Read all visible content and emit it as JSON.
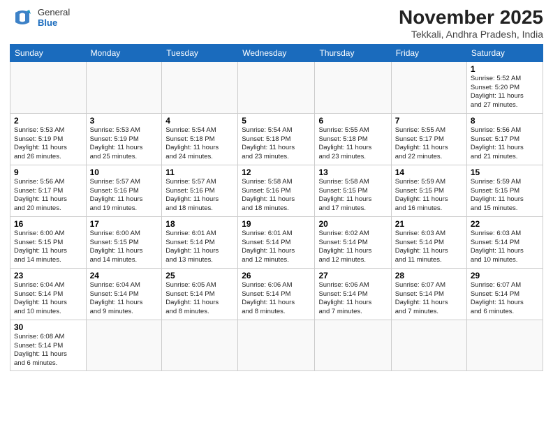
{
  "header": {
    "logo_line1": "General",
    "logo_line2": "Blue",
    "month_title": "November 2025",
    "location": "Tekkali, Andhra Pradesh, India"
  },
  "days": [
    "Sunday",
    "Monday",
    "Tuesday",
    "Wednesday",
    "Thursday",
    "Friday",
    "Saturday"
  ],
  "weeks": [
    [
      {
        "date": "",
        "info": ""
      },
      {
        "date": "",
        "info": ""
      },
      {
        "date": "",
        "info": ""
      },
      {
        "date": "",
        "info": ""
      },
      {
        "date": "",
        "info": ""
      },
      {
        "date": "",
        "info": ""
      },
      {
        "date": "1",
        "info": "Sunrise: 5:52 AM\nSunset: 5:20 PM\nDaylight: 11 hours\nand 27 minutes."
      }
    ],
    [
      {
        "date": "2",
        "info": "Sunrise: 5:53 AM\nSunset: 5:19 PM\nDaylight: 11 hours\nand 26 minutes."
      },
      {
        "date": "3",
        "info": "Sunrise: 5:53 AM\nSunset: 5:19 PM\nDaylight: 11 hours\nand 25 minutes."
      },
      {
        "date": "4",
        "info": "Sunrise: 5:54 AM\nSunset: 5:18 PM\nDaylight: 11 hours\nand 24 minutes."
      },
      {
        "date": "5",
        "info": "Sunrise: 5:54 AM\nSunset: 5:18 PM\nDaylight: 11 hours\nand 23 minutes."
      },
      {
        "date": "6",
        "info": "Sunrise: 5:55 AM\nSunset: 5:18 PM\nDaylight: 11 hours\nand 23 minutes."
      },
      {
        "date": "7",
        "info": "Sunrise: 5:55 AM\nSunset: 5:17 PM\nDaylight: 11 hours\nand 22 minutes."
      },
      {
        "date": "8",
        "info": "Sunrise: 5:56 AM\nSunset: 5:17 PM\nDaylight: 11 hours\nand 21 minutes."
      }
    ],
    [
      {
        "date": "9",
        "info": "Sunrise: 5:56 AM\nSunset: 5:17 PM\nDaylight: 11 hours\nand 20 minutes."
      },
      {
        "date": "10",
        "info": "Sunrise: 5:57 AM\nSunset: 5:16 PM\nDaylight: 11 hours\nand 19 minutes."
      },
      {
        "date": "11",
        "info": "Sunrise: 5:57 AM\nSunset: 5:16 PM\nDaylight: 11 hours\nand 18 minutes."
      },
      {
        "date": "12",
        "info": "Sunrise: 5:58 AM\nSunset: 5:16 PM\nDaylight: 11 hours\nand 18 minutes."
      },
      {
        "date": "13",
        "info": "Sunrise: 5:58 AM\nSunset: 5:15 PM\nDaylight: 11 hours\nand 17 minutes."
      },
      {
        "date": "14",
        "info": "Sunrise: 5:59 AM\nSunset: 5:15 PM\nDaylight: 11 hours\nand 16 minutes."
      },
      {
        "date": "15",
        "info": "Sunrise: 5:59 AM\nSunset: 5:15 PM\nDaylight: 11 hours\nand 15 minutes."
      }
    ],
    [
      {
        "date": "16",
        "info": "Sunrise: 6:00 AM\nSunset: 5:15 PM\nDaylight: 11 hours\nand 14 minutes."
      },
      {
        "date": "17",
        "info": "Sunrise: 6:00 AM\nSunset: 5:15 PM\nDaylight: 11 hours\nand 14 minutes."
      },
      {
        "date": "18",
        "info": "Sunrise: 6:01 AM\nSunset: 5:14 PM\nDaylight: 11 hours\nand 13 minutes."
      },
      {
        "date": "19",
        "info": "Sunrise: 6:01 AM\nSunset: 5:14 PM\nDaylight: 11 hours\nand 12 minutes."
      },
      {
        "date": "20",
        "info": "Sunrise: 6:02 AM\nSunset: 5:14 PM\nDaylight: 11 hours\nand 12 minutes."
      },
      {
        "date": "21",
        "info": "Sunrise: 6:03 AM\nSunset: 5:14 PM\nDaylight: 11 hours\nand 11 minutes."
      },
      {
        "date": "22",
        "info": "Sunrise: 6:03 AM\nSunset: 5:14 PM\nDaylight: 11 hours\nand 10 minutes."
      }
    ],
    [
      {
        "date": "23",
        "info": "Sunrise: 6:04 AM\nSunset: 5:14 PM\nDaylight: 11 hours\nand 10 minutes."
      },
      {
        "date": "24",
        "info": "Sunrise: 6:04 AM\nSunset: 5:14 PM\nDaylight: 11 hours\nand 9 minutes."
      },
      {
        "date": "25",
        "info": "Sunrise: 6:05 AM\nSunset: 5:14 PM\nDaylight: 11 hours\nand 8 minutes."
      },
      {
        "date": "26",
        "info": "Sunrise: 6:06 AM\nSunset: 5:14 PM\nDaylight: 11 hours\nand 8 minutes."
      },
      {
        "date": "27",
        "info": "Sunrise: 6:06 AM\nSunset: 5:14 PM\nDaylight: 11 hours\nand 7 minutes."
      },
      {
        "date": "28",
        "info": "Sunrise: 6:07 AM\nSunset: 5:14 PM\nDaylight: 11 hours\nand 7 minutes."
      },
      {
        "date": "29",
        "info": "Sunrise: 6:07 AM\nSunset: 5:14 PM\nDaylight: 11 hours\nand 6 minutes."
      }
    ],
    [
      {
        "date": "30",
        "info": "Sunrise: 6:08 AM\nSunset: 5:14 PM\nDaylight: 11 hours\nand 6 minutes."
      },
      {
        "date": "",
        "info": ""
      },
      {
        "date": "",
        "info": ""
      },
      {
        "date": "",
        "info": ""
      },
      {
        "date": "",
        "info": ""
      },
      {
        "date": "",
        "info": ""
      },
      {
        "date": "",
        "info": ""
      }
    ]
  ]
}
